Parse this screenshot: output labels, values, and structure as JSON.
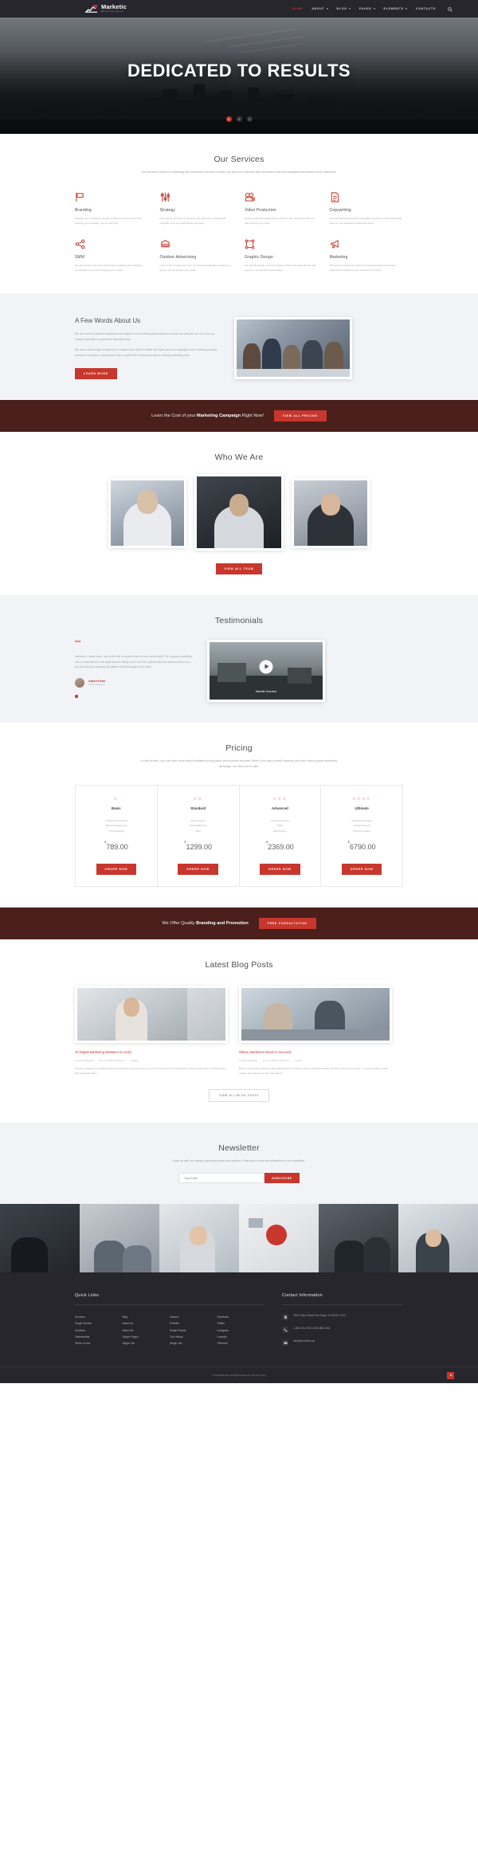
{
  "brand": {
    "name": "Marketic",
    "tagline": "Marketing Agency",
    "logo_icon": "chart-arrow-icon"
  },
  "nav": {
    "items": [
      {
        "label": "HOME",
        "has_dropdown": false,
        "active": true
      },
      {
        "label": "ABOUT",
        "has_dropdown": true,
        "active": false
      },
      {
        "label": "BLOG",
        "has_dropdown": true,
        "active": false
      },
      {
        "label": "PAGES",
        "has_dropdown": true,
        "active": false
      },
      {
        "label": "ELEMENTS",
        "has_dropdown": true,
        "active": false
      },
      {
        "label": "CONTACTS",
        "has_dropdown": false,
        "active": false
      }
    ],
    "search_icon": "search-icon"
  },
  "hero": {
    "title": "DEDICATED TO RESULTS",
    "slides": [
      "1",
      "2",
      "3"
    ],
    "active_slide": 0
  },
  "services": {
    "title": "Our Services",
    "subtitle": "We provide a variety of marketing and promotion services to make you and your business with innovative tools and strategies and attract more customers.",
    "items": [
      {
        "icon": "flag-icon",
        "name": "Branding",
        "text": "Whether you're looking to launch a brand or you just need help injecting your message, we can help you."
      },
      {
        "icon": "sliders-icon",
        "name": "Strategy",
        "text": "Our experts can help you develop and implement strategy and integrate it into your advertising campaign."
      },
      {
        "icon": "video-camera-icon",
        "name": "Video Production",
        "text": "Need a professional advertising video for your campaign? We can offer anything you need."
      },
      {
        "icon": "document-icon",
        "name": "Copywriting",
        "text": "Our experienced copywriters will gladly provide you with high-quality texts for your websites or advertisements."
      },
      {
        "icon": "share-icon",
        "name": "SMM",
        "text": "We can develop a simple social media marketing plan designed specifically for your business and your needs."
      },
      {
        "icon": "billboard-icon",
        "name": "Outdoor Advertising",
        "text": "If you need to create your own out-of-home campaign or lease your assets, we can satisfy your needs."
      },
      {
        "icon": "crop-icon",
        "name": "Graphic Design",
        "text": "Our graphic design services include printing and media identity and logos for your advertising campaign."
      },
      {
        "icon": "megaphone-icon",
        "name": "Marketing",
        "text": "This service includes a variety of promotional tasks aimed and methods that will boost your company's products."
      }
    ]
  },
  "about": {
    "title": "A Few Words About Us",
    "paragraphs": [
      "We are a team of talented marketers who happen to love creating smart ideas for brands who will have us. Our own, our creative approach to provide the essential ideas.",
      "We have a wide range of experience, expertise and skills to create and implement your campaigns, from creating cracking awesome concepts to optimizing to kick our great SEO network as well as ordinary marketing tools."
    ],
    "button": "LEARN MORE",
    "image_alt": "team-meeting-photo"
  },
  "cta_marketing": {
    "text_before": "Learn the Cost of your ",
    "text_bold": "Marketing Campaign",
    "text_after": " Right Now!",
    "button": "VIEW ALL PRICING"
  },
  "team": {
    "title": "Who We Are",
    "members": [
      {
        "name": "team-member-1",
        "style": "light"
      },
      {
        "name": "team-member-2",
        "style": "dark"
      },
      {
        "name": "team-member-3",
        "style": "light"
      }
    ],
    "button": "VIEW ALL TEAM"
  },
  "testimonials": {
    "title": "Testimonials",
    "quote_icon": "quote-icon",
    "text": "Marketic is, hands down, one of the best companies that we have worked with! The company, marketing, new or exceeded all of the goals that we initially set for all of the projects that they implemented for us. I am sure that your company will partner with them again in the future.",
    "author": "Albert Peter",
    "role": "CEO of Webstore",
    "dots": 1,
    "video_caption": "Marketic Overview",
    "play_icon": "play-icon"
  },
  "pricing": {
    "title": "Pricing",
    "subtitle": "In this section, you can learn more about available pricing plans and included services. Even if you own a small business and don't need a great marketing campaign, we have one to offer.",
    "plans": [
      {
        "stars": 1,
        "name": "Basic",
        "features": [
          "Analysis & Research",
          "Brand Management",
          "CTR Marketing"
        ],
        "currency": "$",
        "price": "789.00",
        "button": "ORDER NOW"
      },
      {
        "stars": 2,
        "name": "Standard",
        "features": [
          "Basic Growth",
          "Email Marketing",
          "SEO"
        ],
        "currency": "$",
        "price": "1299.00",
        "button": "ORDER NOW"
      },
      {
        "stars": 3,
        "name": "Advanced",
        "features": [
          "Online Marketing",
          "SMM",
          "Web Design"
        ],
        "currency": "$",
        "price": "2369.00",
        "button": "ORDER NOW"
      },
      {
        "stars": 4,
        "name": "Ultimate",
        "features": [
          "Marketing Strategy",
          "Graphic Design",
          "Content Creation"
        ],
        "currency": "$",
        "price": "6790.00",
        "button": "ORDER NOW"
      }
    ]
  },
  "cta_branding": {
    "text_before": "We Offer Quality ",
    "text_bold": "Branding and Promotion",
    "button": "FREE CONSULTATION"
  },
  "blog": {
    "title": "Latest Blog Posts",
    "posts": [
      {
        "title": "10 Digital Marketing Mistakes to Avoid",
        "author": "by Thomas Barlow",
        "date": "Nov 10, 2018 at 10:03 pm",
        "comments": "1 Views",
        "excerpt": "Though managing your digital marketing campaign may seem easy, you can encounter some complexities, which usually lead to mistakes and bad promotion effect."
      },
      {
        "title": "Where Marketers Need to Succeed",
        "author": "by Thomas Barlow",
        "date": "Nov 10, 2018 at 10:03 am",
        "comments": "1 Views",
        "excerpt": "Being a successful marketer totally might appear to require a deep ending list of skills. Simple to pay need to excel — content creation, social media, web analytics, at all of the above?"
      }
    ],
    "button": "VIEW ALL BLOG POSTS"
  },
  "newsletter": {
    "title": "Newsletter",
    "subtitle": "Keep up with our always upcoming news and updates. Enter your e-mail and subscribe to our newsletter.",
    "placeholder": "Your e-mail",
    "button": "SUBSCRIBE"
  },
  "gallery": {
    "items": [
      "gallery-1",
      "gallery-2",
      "gallery-3",
      "gallery-4",
      "gallery-5",
      "gallery-6"
    ]
  },
  "footer": {
    "quick_links_title": "Quick Links",
    "columns": [
      [
        "Services",
        "Single Service",
        "Contacts",
        "Testimonials",
        "Terms of Use"
      ],
      [
        "Blog",
        "About Us",
        "About Me",
        "Single Project",
        "Single Job"
      ],
      [
        "Careers",
        "Portfolio",
        "Single Project",
        "Our History",
        "Single Job"
      ],
      [
        "Facebook",
        "Twitter",
        "Instagram",
        "LinkedIn",
        "Pinterest"
      ]
    ],
    "contact_title": "Contact Information",
    "contacts": [
      {
        "icon": "location-icon",
        "text": "3100 Fulton Street San Diego, CA 84117-1234"
      },
      {
        "icon": "phone-icon",
        "text": "1-800-224-4785\n1-800-658-1281"
      },
      {
        "icon": "mail-icon",
        "text": "info@demolink.org"
      }
    ],
    "copyright": "© 2019 Marketic. All Rights Reserved. Privacy Policy",
    "privacy_link": "Privacy Policy",
    "to_top_icon": "arrow-up-icon"
  }
}
